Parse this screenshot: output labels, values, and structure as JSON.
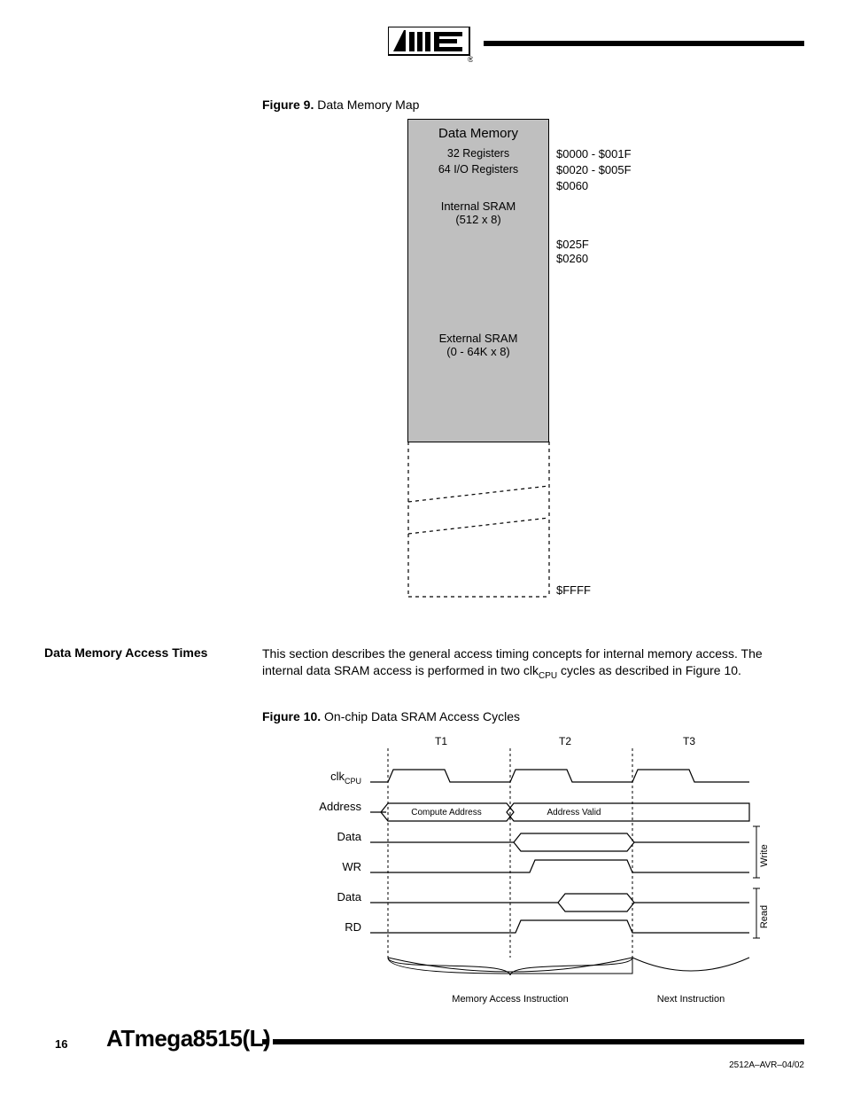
{
  "figure9": {
    "caption_label": "Figure 9.",
    "caption_text": "Data Memory Map",
    "title": "Data Memory",
    "reg32": "32 Registers",
    "reg64": "64 I/O Registers",
    "isram_l1": "Internal SRAM",
    "isram_l2": "(512 x 8)",
    "esram_l1": "External SRAM",
    "esram_l2": "(0 - 64K x 8)",
    "addr_reg32": "$0000 - $001F",
    "addr_reg64": "$0020 - $005F",
    "addr_isram_start": "$0060",
    "addr_isram_end": "$025F",
    "addr_esram_start": "$0260",
    "addr_end": "$FFFF"
  },
  "section_access": {
    "heading": "Data Memory Access Times",
    "body_pre": "This section describes the general access timing concepts for internal memory access. The internal data SRAM access is performed in two clk",
    "body_sub": "CPU",
    "body_post": " cycles as described in Figure 10."
  },
  "figure10": {
    "caption_label": "Figure 10.",
    "caption_text": "On-chip Data SRAM Access Cycles",
    "t1": "T1",
    "t2": "T2",
    "t3": "T3",
    "clk_label": "clk",
    "clk_sub": "CPU",
    "address_label": "Address",
    "data_label": "Data",
    "wr_label": "WR",
    "rd_label": "RD",
    "compute_address": "Compute Address",
    "address_valid": "Address Valid",
    "write_label": "Write",
    "read_label": "Read",
    "mem_instr": "Memory Access Instruction",
    "next_instr": "Next Instruction"
  },
  "footer": {
    "page_number": "16",
    "chip_name": "ATmega8515(L)",
    "doc_id": "2512A–AVR–04/02"
  }
}
